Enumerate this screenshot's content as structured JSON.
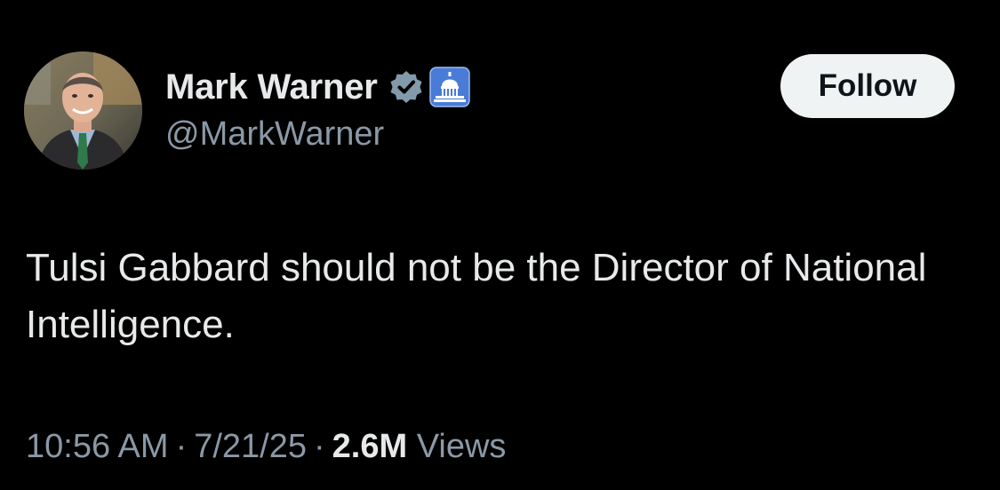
{
  "author": {
    "display_name": "Mark Warner",
    "handle": "@MarkWarner",
    "badges": [
      "verified-check-icon",
      "government-capitol-icon"
    ]
  },
  "follow_button": {
    "label": "Follow"
  },
  "tweet": {
    "text": "Tulsi Gabbard should not be the Director of National Intelligence."
  },
  "meta": {
    "time": "10:56 AM",
    "separator": "·",
    "date": "7/21/25",
    "views_count": "2.6M",
    "views_label": "Views"
  },
  "colors": {
    "background": "#000000",
    "primary_text": "#e7e9ea",
    "secondary_text": "#8b98a5",
    "follow_bg": "#eff3f4",
    "follow_text": "#0f1419",
    "verified_badge": "#829aab",
    "gov_badge": "#4a7bd6"
  }
}
